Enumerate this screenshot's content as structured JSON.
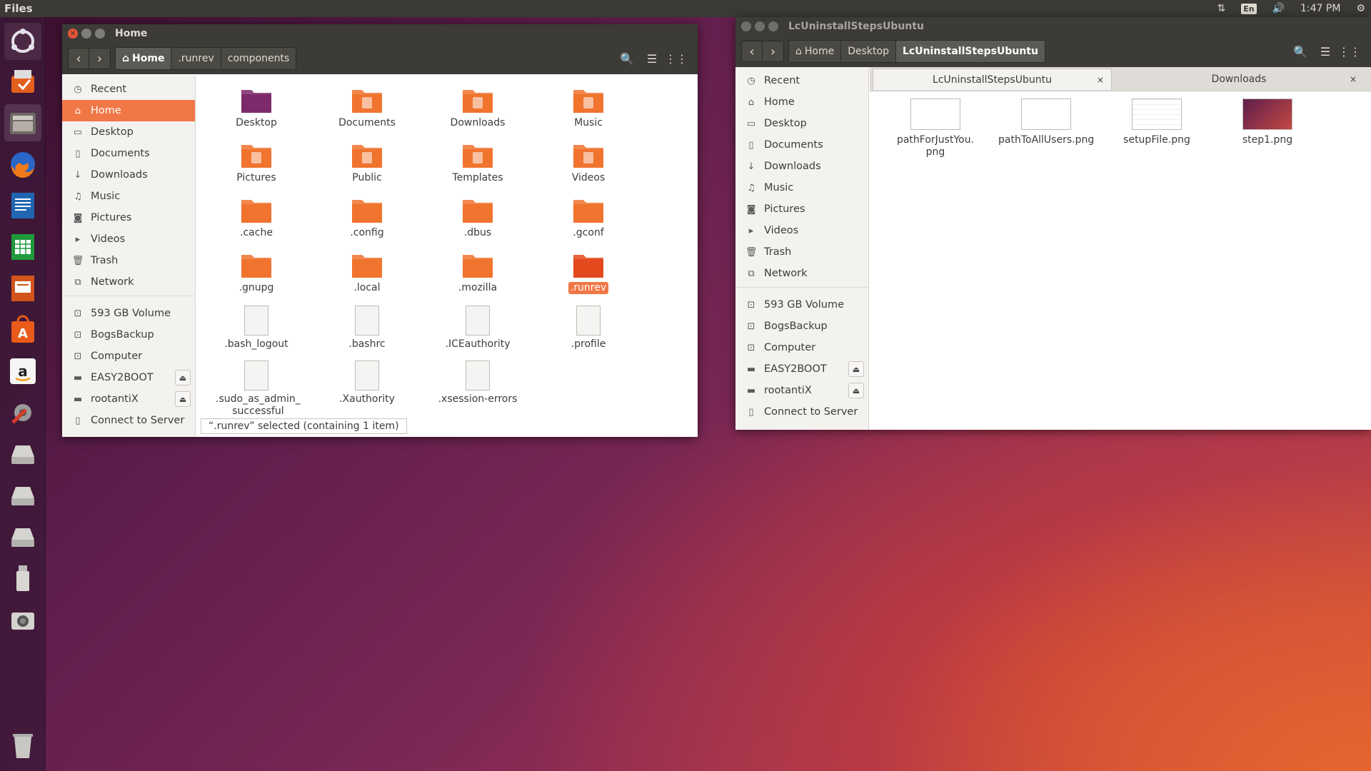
{
  "top_panel": {
    "app_name": "Files",
    "keyboard_layout": "En",
    "clock": "1:47 PM"
  },
  "launcher": {
    "items": [
      "ubuntu-dash-icon",
      "system-updater-icon",
      "files-icon",
      "firefox-icon",
      "libreoffice-writer-icon",
      "libreoffice-calc-icon",
      "libreoffice-impress-icon",
      "software-center-icon",
      "amazon-icon",
      "system-settings-icon",
      "drive-icon",
      "drive-icon",
      "drive-icon",
      "usb-drive-icon",
      "camera-icon",
      "trash-icon"
    ]
  },
  "window_home": {
    "title": "Home",
    "breadcrumbs": [
      "Home",
      ".runrev",
      "components"
    ],
    "sidebar": {
      "places": [
        "Recent",
        "Home",
        "Desktop",
        "Documents",
        "Downloads",
        "Music",
        "Pictures",
        "Videos",
        "Trash",
        "Network"
      ],
      "devices": [
        "593 GB Volume",
        "BogsBackup",
        "Computer",
        "EASY2BOOT",
        "rootantiX",
        "Connect to Server"
      ]
    },
    "files": [
      "Desktop",
      "Documents",
      "Downloads",
      "Music",
      "Pictures",
      "Public",
      "Templates",
      "Videos",
      ".cache",
      ".config",
      ".dbus",
      ".gconf",
      ".gnupg",
      ".local",
      ".mozilla",
      ".runrev",
      ".bash_logout",
      ".bashrc",
      ".ICEauthority",
      ".profile",
      ".sudo_as_admin_\nsuccessful",
      ".Xauthority",
      ".xsession-errors"
    ],
    "status": "“.runrev” selected  (containing 1 item)"
  },
  "window_lc": {
    "title": "LcUninstallStepsUbuntu",
    "breadcrumbs": [
      "Home",
      "Desktop",
      "LcUninstallStepsUbuntu"
    ],
    "sidebar": {
      "places": [
        "Recent",
        "Home",
        "Desktop",
        "Documents",
        "Downloads",
        "Music",
        "Pictures",
        "Videos",
        "Trash",
        "Network"
      ],
      "devices": [
        "593 GB Volume",
        "BogsBackup",
        "Computer",
        "EASY2BOOT",
        "rootantiX",
        "Connect to Server"
      ]
    },
    "tabs": [
      "LcUninstallStepsUbuntu",
      "Downloads"
    ],
    "files": [
      "pathForJustYou.\npng",
      "pathToAllUsers.png",
      "setupFile.png",
      "step1.png"
    ]
  },
  "colors": {
    "accent": "#f07746",
    "panel": "#3c3b37",
    "folder": "#f0732e"
  }
}
